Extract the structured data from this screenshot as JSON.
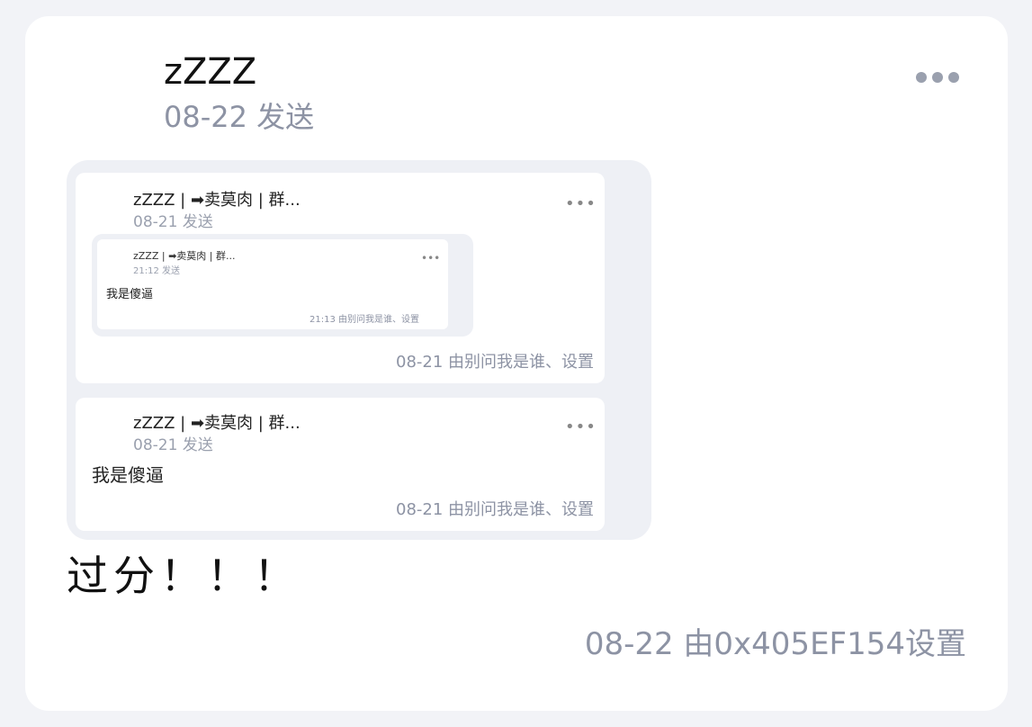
{
  "post": {
    "author": "zZZZ",
    "meta": "08-22 发送",
    "body": "过分！！！",
    "footer": "08-22 由0x405EF154设置"
  },
  "quoted": [
    {
      "author": "zZZZ | ➡卖莫肉 | 群...",
      "meta": "08-21 发送",
      "nested": {
        "author": "zZZZ | ➡卖莫肉 | 群...",
        "meta": "21:12 发送",
        "body": "我是傻逼",
        "footer": "21:13 由别问我是谁、设置"
      },
      "footer": "08-21 由别问我是谁、设置"
    },
    {
      "author": "zZZZ | ➡卖莫肉 | 群...",
      "meta": "08-21 发送",
      "body": "我是傻逼",
      "footer": "08-21 由别问我是谁、设置"
    }
  ],
  "icons": {
    "more": "more-horizontal-icon"
  }
}
